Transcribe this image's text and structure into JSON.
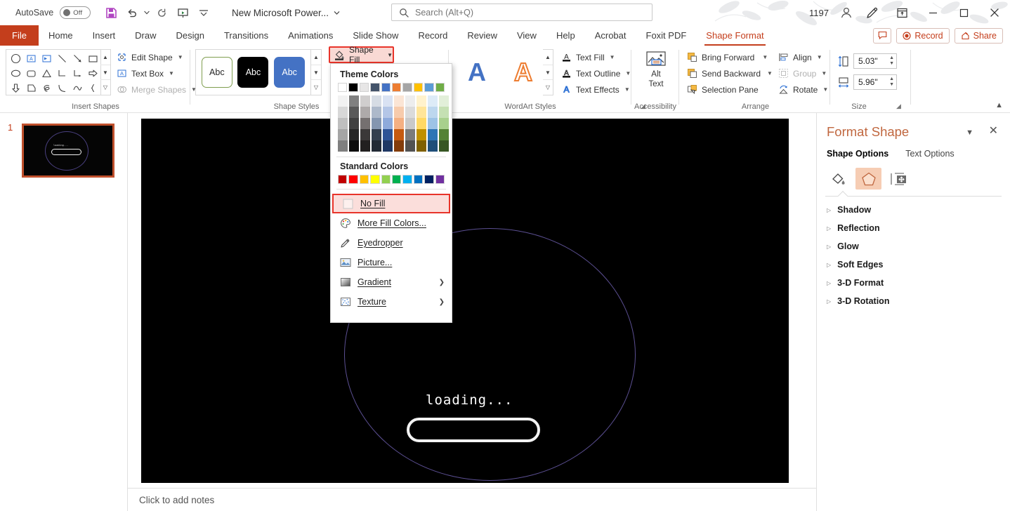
{
  "titlebar": {
    "autosave_label": "AutoSave",
    "toggle_state": "Off",
    "document_title": "New Microsoft Power...",
    "user_count": "1197",
    "quick_access": [
      {
        "name": "save-icon",
        "label": "Save"
      },
      {
        "name": "undo-icon",
        "label": "Undo"
      },
      {
        "name": "redo-icon",
        "label": "Redo"
      },
      {
        "name": "start-presentation-icon",
        "label": "Start From Beginning"
      },
      {
        "name": "customize-qat-icon",
        "label": "Customize Quick Access Toolbar"
      }
    ],
    "window_buttons": [
      {
        "name": "ribbon-display-options-icon",
        "label": "Ribbon Display Options"
      },
      {
        "name": "minimize-icon",
        "label": "Minimize"
      },
      {
        "name": "maximize-icon",
        "label": "Maximize"
      },
      {
        "name": "close-icon",
        "label": "Close"
      }
    ]
  },
  "search": {
    "placeholder": "Search (Alt+Q)",
    "value": "",
    "icon": "search-icon"
  },
  "tabs": [
    {
      "label": "File",
      "active": false,
      "file": true
    },
    {
      "label": "Home",
      "active": false
    },
    {
      "label": "Insert",
      "active": false
    },
    {
      "label": "Draw",
      "active": false
    },
    {
      "label": "Design",
      "active": false
    },
    {
      "label": "Transitions",
      "active": false
    },
    {
      "label": "Animations",
      "active": false
    },
    {
      "label": "Slide Show",
      "active": false
    },
    {
      "label": "Record",
      "active": false
    },
    {
      "label": "Review",
      "active": false
    },
    {
      "label": "View",
      "active": false
    },
    {
      "label": "Help",
      "active": false
    },
    {
      "label": "Acrobat",
      "active": false
    },
    {
      "label": "Foxit PDF",
      "active": false
    },
    {
      "label": "Shape Format",
      "active": true
    }
  ],
  "tabs_right": {
    "comments_icon": "comment-icon",
    "record_label": "Record",
    "share_label": "Share"
  },
  "ribbon": {
    "groups": [
      {
        "label": "Insert Shapes"
      },
      {
        "label": "Shape Styles"
      },
      {
        "label": "WordArt Styles"
      },
      {
        "label": "Accessibility"
      },
      {
        "label": "Arrange"
      },
      {
        "label": "Size"
      }
    ],
    "insert_shapes": {
      "commands": [
        {
          "label": "Edit Shape",
          "icon": "edit-shape-icon",
          "dropdown": true,
          "disabled": false
        },
        {
          "label": "Text Box",
          "icon": "text-box-icon",
          "dropdown": true,
          "disabled": false
        },
        {
          "label": "Merge Shapes",
          "icon": "merge-shapes-icon",
          "dropdown": true,
          "disabled": true
        }
      ]
    },
    "shape_styles": {
      "tiles": [
        {
          "label": "Abc",
          "fill": "#ffffff",
          "stroke": "#7f9e4f",
          "text": "#262626"
        },
        {
          "label": "Abc",
          "fill": "#000000",
          "stroke": "#000000",
          "text": "#ffffff"
        },
        {
          "label": "Abc",
          "fill": "#4472c4",
          "stroke": "#4472c4",
          "text": "#ffffff"
        }
      ],
      "shape_fill_label": "Shape Fill"
    },
    "wordart_styles": {
      "samples": [
        {
          "label": "A",
          "color": "#4472c4"
        },
        {
          "label": "A",
          "color": "#ed7d31"
        }
      ],
      "commands": [
        {
          "label": "Text Fill",
          "icon": "text-fill-icon",
          "dropdown": true
        },
        {
          "label": "Text Outline",
          "icon": "text-outline-icon",
          "dropdown": true
        },
        {
          "label": "Text Effects",
          "icon": "text-effects-icon",
          "dropdown": true
        }
      ]
    },
    "accessibility": {
      "alt_text_line1": "Alt",
      "alt_text_line2": "Text",
      "icon": "alt-text-icon"
    },
    "arrange": {
      "commands": [
        {
          "label": "Bring Forward",
          "icon": "bring-forward-icon",
          "dropdown": true,
          "disabled": false
        },
        {
          "label": "Send Backward",
          "icon": "send-backward-icon",
          "dropdown": true,
          "disabled": false
        },
        {
          "label": "Selection Pane",
          "icon": "selection-pane-icon",
          "dropdown": false,
          "disabled": false
        },
        {
          "label": "Align",
          "icon": "align-icon",
          "dropdown": true,
          "disabled": false
        },
        {
          "label": "Group",
          "icon": "group-icon",
          "dropdown": true,
          "disabled": true
        },
        {
          "label": "Rotate",
          "icon": "rotate-icon",
          "dropdown": true,
          "disabled": false
        }
      ]
    },
    "size": {
      "height_value": "5.03\"",
      "height_icon": "shape-height-icon",
      "width_value": "5.96\"",
      "width_icon": "shape-width-icon",
      "dialog_launcher": "size-dialog-launcher"
    },
    "collapse_icon": "collapse-ribbon-icon"
  },
  "shape_fill_menu": {
    "theme_colors_heading": "Theme Colors",
    "standard_colors_heading": "Standard Colors",
    "theme_columns": [
      {
        "base": "#ffffff",
        "variants": [
          "#f2f2f2",
          "#d8d8d8",
          "#bfbfbf",
          "#a5a5a5",
          "#7f7f7f"
        ]
      },
      {
        "base": "#000000",
        "variants": [
          "#808080",
          "#595959",
          "#404040",
          "#262626",
          "#0d0d0d"
        ]
      },
      {
        "base": "#e7e6e6",
        "variants": [
          "#d0cece",
          "#aeaaaa",
          "#757070",
          "#3b3838",
          "#222020"
        ]
      },
      {
        "base": "#44546a",
        "variants": [
          "#d6dce4",
          "#adb9ca",
          "#8496b0",
          "#333f4f",
          "#222a35"
        ]
      },
      {
        "base": "#4472c4",
        "variants": [
          "#d9e2f3",
          "#b4c6e7",
          "#8eaadb",
          "#2f5496",
          "#1f3864"
        ]
      },
      {
        "base": "#ed7d31",
        "variants": [
          "#fbe5d5",
          "#f7cbac",
          "#f4b083",
          "#c55a11",
          "#833c0b"
        ]
      },
      {
        "base": "#a5a5a5",
        "variants": [
          "#ededed",
          "#dbdbdb",
          "#c9c9c9",
          "#7b7b7b",
          "#525252"
        ]
      },
      {
        "base": "#ffc000",
        "variants": [
          "#fff2cc",
          "#ffe599",
          "#ffd965",
          "#bf9000",
          "#7f6000"
        ]
      },
      {
        "base": "#5b9bd5",
        "variants": [
          "#ddebf7",
          "#bdd7ee",
          "#9dc3e6",
          "#2e75b5",
          "#1f4e79"
        ]
      },
      {
        "base": "#70ad47",
        "variants": [
          "#e2efd9",
          "#c5e0b3",
          "#a8d08d",
          "#548235",
          "#375623"
        ]
      }
    ],
    "standard_colors": [
      "#c00000",
      "#ff0000",
      "#ffc000",
      "#ffff00",
      "#92d050",
      "#00b050",
      "#00b0f0",
      "#0070c0",
      "#002060",
      "#7030a0"
    ],
    "items": [
      {
        "label": "No Fill",
        "icon": "no-fill-icon",
        "submenu": false,
        "highlighted": true
      },
      {
        "label": "More Fill Colors...",
        "icon": "palette-icon",
        "submenu": false,
        "highlighted": false
      },
      {
        "label": "Eyedropper",
        "icon": "eyedropper-icon",
        "submenu": false,
        "highlighted": false
      },
      {
        "label": "Picture...",
        "icon": "picture-icon",
        "submenu": false,
        "highlighted": false
      },
      {
        "label": "Gradient",
        "icon": "gradient-icon",
        "submenu": true,
        "highlighted": false
      },
      {
        "label": "Texture",
        "icon": "texture-icon",
        "submenu": true,
        "highlighted": false
      }
    ]
  },
  "thumbnails": [
    {
      "number": "1",
      "selected": true
    }
  ],
  "slide": {
    "background": "#000000",
    "loading_text": "loading...",
    "progress_bar_color": "#f2f2f2",
    "circle_color": "#5b4f92"
  },
  "notes": {
    "placeholder": "Click to add notes"
  },
  "format_pane": {
    "title": "Format Shape",
    "dropdown_icon": "pane-options-icon",
    "close_icon": "pane-close-icon",
    "tabs": [
      {
        "label": "Shape Options",
        "active": true
      },
      {
        "label": "Text Options",
        "active": false
      }
    ],
    "icon_tabs": [
      {
        "name": "fill-line-icon",
        "selected": false
      },
      {
        "name": "effects-icon",
        "selected": true
      },
      {
        "name": "size-properties-icon",
        "selected": false
      }
    ],
    "sections": [
      {
        "label": "Shadow"
      },
      {
        "label": "Reflection"
      },
      {
        "label": "Glow"
      },
      {
        "label": "Soft Edges"
      },
      {
        "label": "3-D Format"
      },
      {
        "label": "3-D Rotation"
      }
    ]
  },
  "colors": {
    "accent": "#c43e1c",
    "highlight_border": "#e8342a",
    "highlight_fill": "#fbdedb"
  }
}
